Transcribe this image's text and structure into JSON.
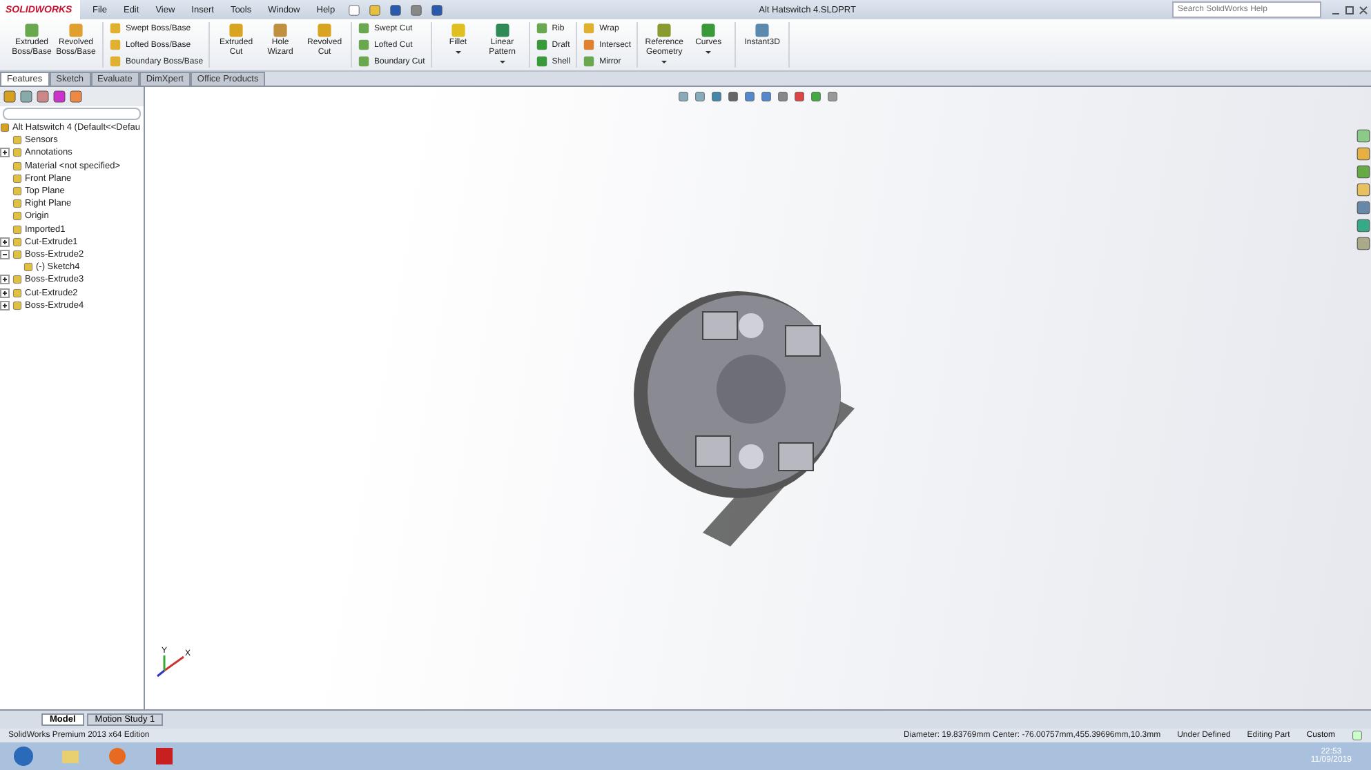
{
  "app": {
    "logo": "SOLIDWORKS",
    "menu": [
      "File",
      "Edit",
      "View",
      "Insert",
      "Tools",
      "Window",
      "Help"
    ],
    "title": "Alt Hatswitch 4.SLDPRT",
    "search": {
      "placeholder": "Search SolidWorks Help"
    }
  },
  "ribbon": [
    {
      "kind": "large",
      "items": [
        {
          "label": "Extruded Boss/Base",
          "color": "#6aa84f"
        },
        {
          "label": "Revolved Boss/Base",
          "color": "#e0a030"
        }
      ]
    },
    {
      "kind": "stack",
      "items": [
        {
          "label": "Swept Boss/Base",
          "color": "#e0b030"
        },
        {
          "label": "Lofted Boss/Base",
          "color": "#e0b030"
        },
        {
          "label": "Boundary Boss/Base",
          "color": "#e0b030"
        }
      ]
    },
    {
      "kind": "large",
      "items": [
        {
          "label": "Extruded Cut",
          "color": "#d9a520"
        },
        {
          "label": "Hole Wizard",
          "color": "#c09040"
        },
        {
          "label": "Revolved Cut",
          "color": "#d9a520"
        }
      ]
    },
    {
      "kind": "stack",
      "items": [
        {
          "label": "Swept Cut",
          "color": "#6aa84f"
        },
        {
          "label": "Lofted Cut",
          "color": "#6aa84f"
        },
        {
          "label": "Boundary Cut",
          "color": "#6aa84f"
        }
      ]
    },
    {
      "kind": "large",
      "items": [
        {
          "label": "Fillet",
          "color": "#e0c020",
          "dropdown": true
        },
        {
          "label": "Linear Pattern",
          "color": "#2e8b57",
          "dropdown": true
        }
      ]
    },
    {
      "kind": "stack",
      "items": [
        {
          "label": "Rib",
          "color": "#6aa84f"
        },
        {
          "label": "Draft",
          "color": "#3a9a3a"
        },
        {
          "label": "Shell",
          "color": "#3a9a3a"
        }
      ]
    },
    {
      "kind": "stack",
      "items": [
        {
          "label": "Wrap",
          "color": "#e0b030"
        },
        {
          "label": "Intersect",
          "color": "#e08030"
        },
        {
          "label": "Mirror",
          "color": "#6aa84f"
        }
      ]
    },
    {
      "kind": "large",
      "items": [
        {
          "label": "Reference Geometry",
          "color": "#8a9a30",
          "dropdown": true
        },
        {
          "label": "Curves",
          "color": "#3a9a3a",
          "dropdown": true
        }
      ]
    },
    {
      "kind": "large",
      "items": [
        {
          "label": "Instant3D",
          "color": "#5b8ab0"
        }
      ]
    }
  ],
  "tabs": [
    {
      "label": "Features",
      "selected": true
    },
    {
      "label": "Sketch",
      "selected": false
    },
    {
      "label": "Evaluate",
      "selected": false
    },
    {
      "label": "DimXpert",
      "selected": false
    },
    {
      "label": "Office Products",
      "selected": false
    }
  ],
  "tree": {
    "root": "Alt Hatswitch 4  (Default<<Defau",
    "items": [
      {
        "label": "Sensors"
      },
      {
        "label": "Annotations",
        "expanded": false
      },
      {
        "label": "Material <not specified>"
      },
      {
        "label": "Front Plane"
      },
      {
        "label": "Top Plane"
      },
      {
        "label": "Right Plane"
      },
      {
        "label": "Origin"
      },
      {
        "label": "Imported1"
      },
      {
        "label": "Cut-Extrude1",
        "expanded": false
      },
      {
        "label": "Boss-Extrude2",
        "expanded": true,
        "children": [
          {
            "label": "(-) Sketch4"
          }
        ]
      },
      {
        "label": "Boss-Extrude3",
        "expanded": false
      },
      {
        "label": "Cut-Extrude2",
        "expanded": false
      },
      {
        "label": "Boss-Extrude4",
        "expanded": false
      }
    ]
  },
  "triad": {
    "x": "X",
    "y": "Y"
  },
  "bottom_tabs": [
    {
      "label": "Model",
      "selected": true
    },
    {
      "label": "Motion Study 1",
      "selected": false
    }
  ],
  "status_bar": {
    "edition": "SolidWorks Premium 2013 x64 Edition",
    "measure": "Diameter: 19.83769mm  Center: -76.00757mm,455.39696mm,10.3mm",
    "state": "Under Defined",
    "mode": "Editing Part",
    "units": "Custom"
  },
  "taskbar": {
    "time": "22:53",
    "date": "11/09/2019"
  }
}
